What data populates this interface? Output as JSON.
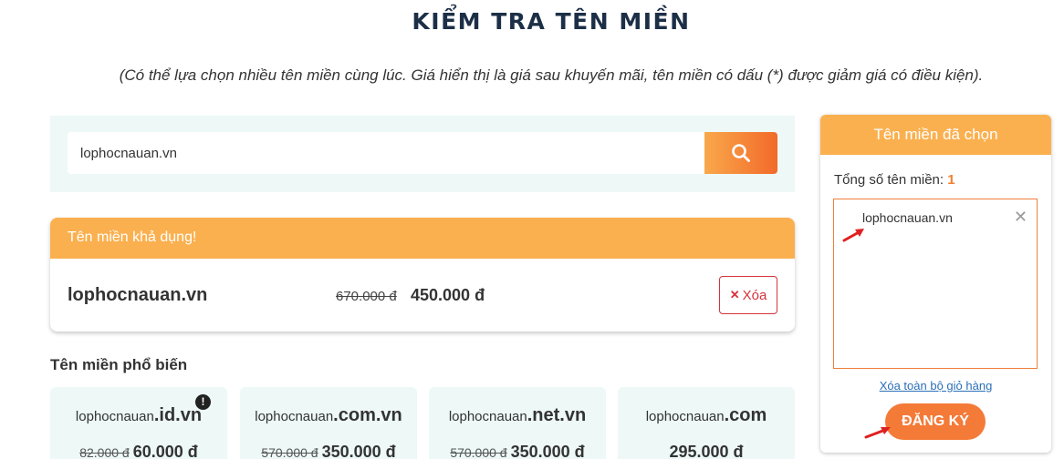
{
  "header": {
    "title": "KIỂM TRA TÊN MIỀN",
    "subtitle": "(Có thể lựa chọn nhiều tên miền cùng lúc. Giá hiển thị là giá sau khuyến mãi, tên miền có dấu (*) được giảm giá có điều kiện)."
  },
  "search": {
    "value": "lophocnauan.vn",
    "button_icon": "search-icon"
  },
  "availability": {
    "heading": "Tên miền khả dụng!",
    "domain": "lophocnauan.vn",
    "old_price": "670.000 đ",
    "new_price": "450.000 đ",
    "remove_icon": "✕",
    "remove_label": "Xóa"
  },
  "popular": {
    "heading": "Tên miền phổ biến",
    "items": [
      {
        "name": "lophocnauan",
        "tld": ".id.vn",
        "old_price": "82.000 đ",
        "price": "60.000 đ",
        "badge": "!"
      },
      {
        "name": "lophocnauan",
        "tld": ".com.vn",
        "old_price": "570.000 đ",
        "price": "350.000 đ"
      },
      {
        "name": "lophocnauan",
        "tld": ".net.vn",
        "old_price": "570.000 đ",
        "price": "350.000 đ"
      },
      {
        "name": "lophocnauan",
        "tld": ".com",
        "old_price": "",
        "price": "295.000 đ"
      }
    ]
  },
  "cart": {
    "heading": "Tên miền đã chọn",
    "count_label": "Tổng số tên miền:",
    "count": "1",
    "items": [
      "lophocnauan.vn"
    ],
    "remove_icon": "✕",
    "clear_all": "Xóa toàn bộ giỏ hàng",
    "register": "ĐĂNG KÝ"
  },
  "colors": {
    "accent": "#fbb04f",
    "button": "#f47a38",
    "danger": "#d6323a",
    "bg_soft": "#edf8f7",
    "title": "#1c2f47"
  }
}
